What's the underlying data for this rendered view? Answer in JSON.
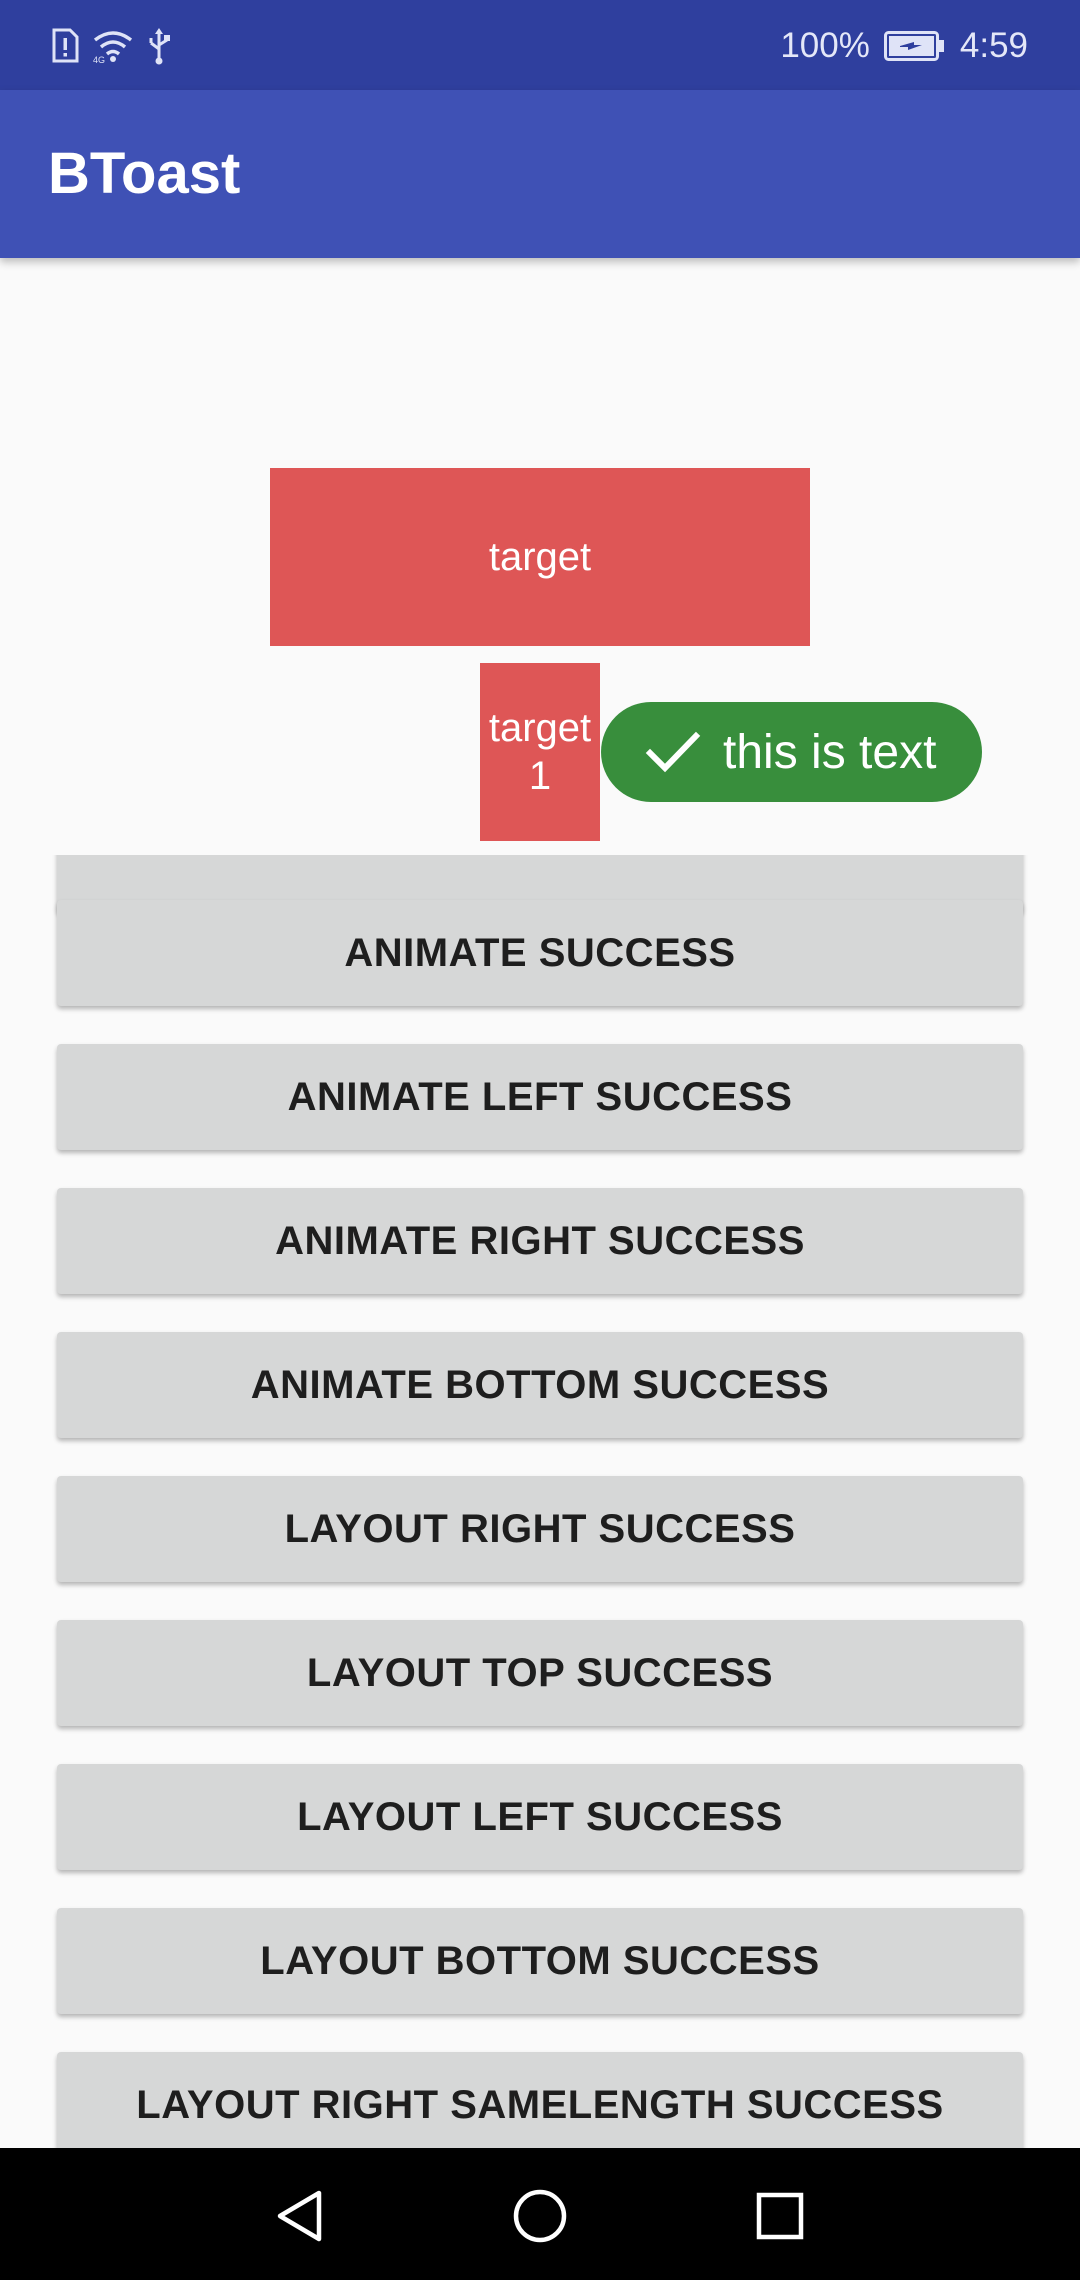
{
  "status_bar": {
    "battery_percent": "100%",
    "time": "4:59",
    "icons": [
      "sim-alert-icon",
      "wifi-icon",
      "usb-icon",
      "battery-charging-icon"
    ]
  },
  "app_bar": {
    "title": "BToast",
    "color": "#3f51b5"
  },
  "targets": {
    "main_label": "target",
    "secondary_label_line1": "target",
    "secondary_label_line2": "1",
    "color": "#de5656"
  },
  "toast": {
    "text": "this is text",
    "icon": "check-icon",
    "color": "#388e3c"
  },
  "buttons": [
    {
      "label": "ANIMATE SUCCESS"
    },
    {
      "label": "ANIMATE LEFT SUCCESS"
    },
    {
      "label": "ANIMATE RIGHT SUCCESS"
    },
    {
      "label": "ANIMATE BOTTOM SUCCESS"
    },
    {
      "label": "LAYOUT RIGHT SUCCESS"
    },
    {
      "label": "LAYOUT TOP SUCCESS"
    },
    {
      "label": "LAYOUT LEFT SUCCESS"
    },
    {
      "label": "LAYOUT BOTTOM SUCCESS"
    },
    {
      "label": "LAYOUT RIGHT SAMELENGTH SUCCESS"
    }
  ],
  "nav_bar": {
    "icons": [
      "back-icon",
      "home-icon",
      "recent-apps-icon"
    ]
  }
}
